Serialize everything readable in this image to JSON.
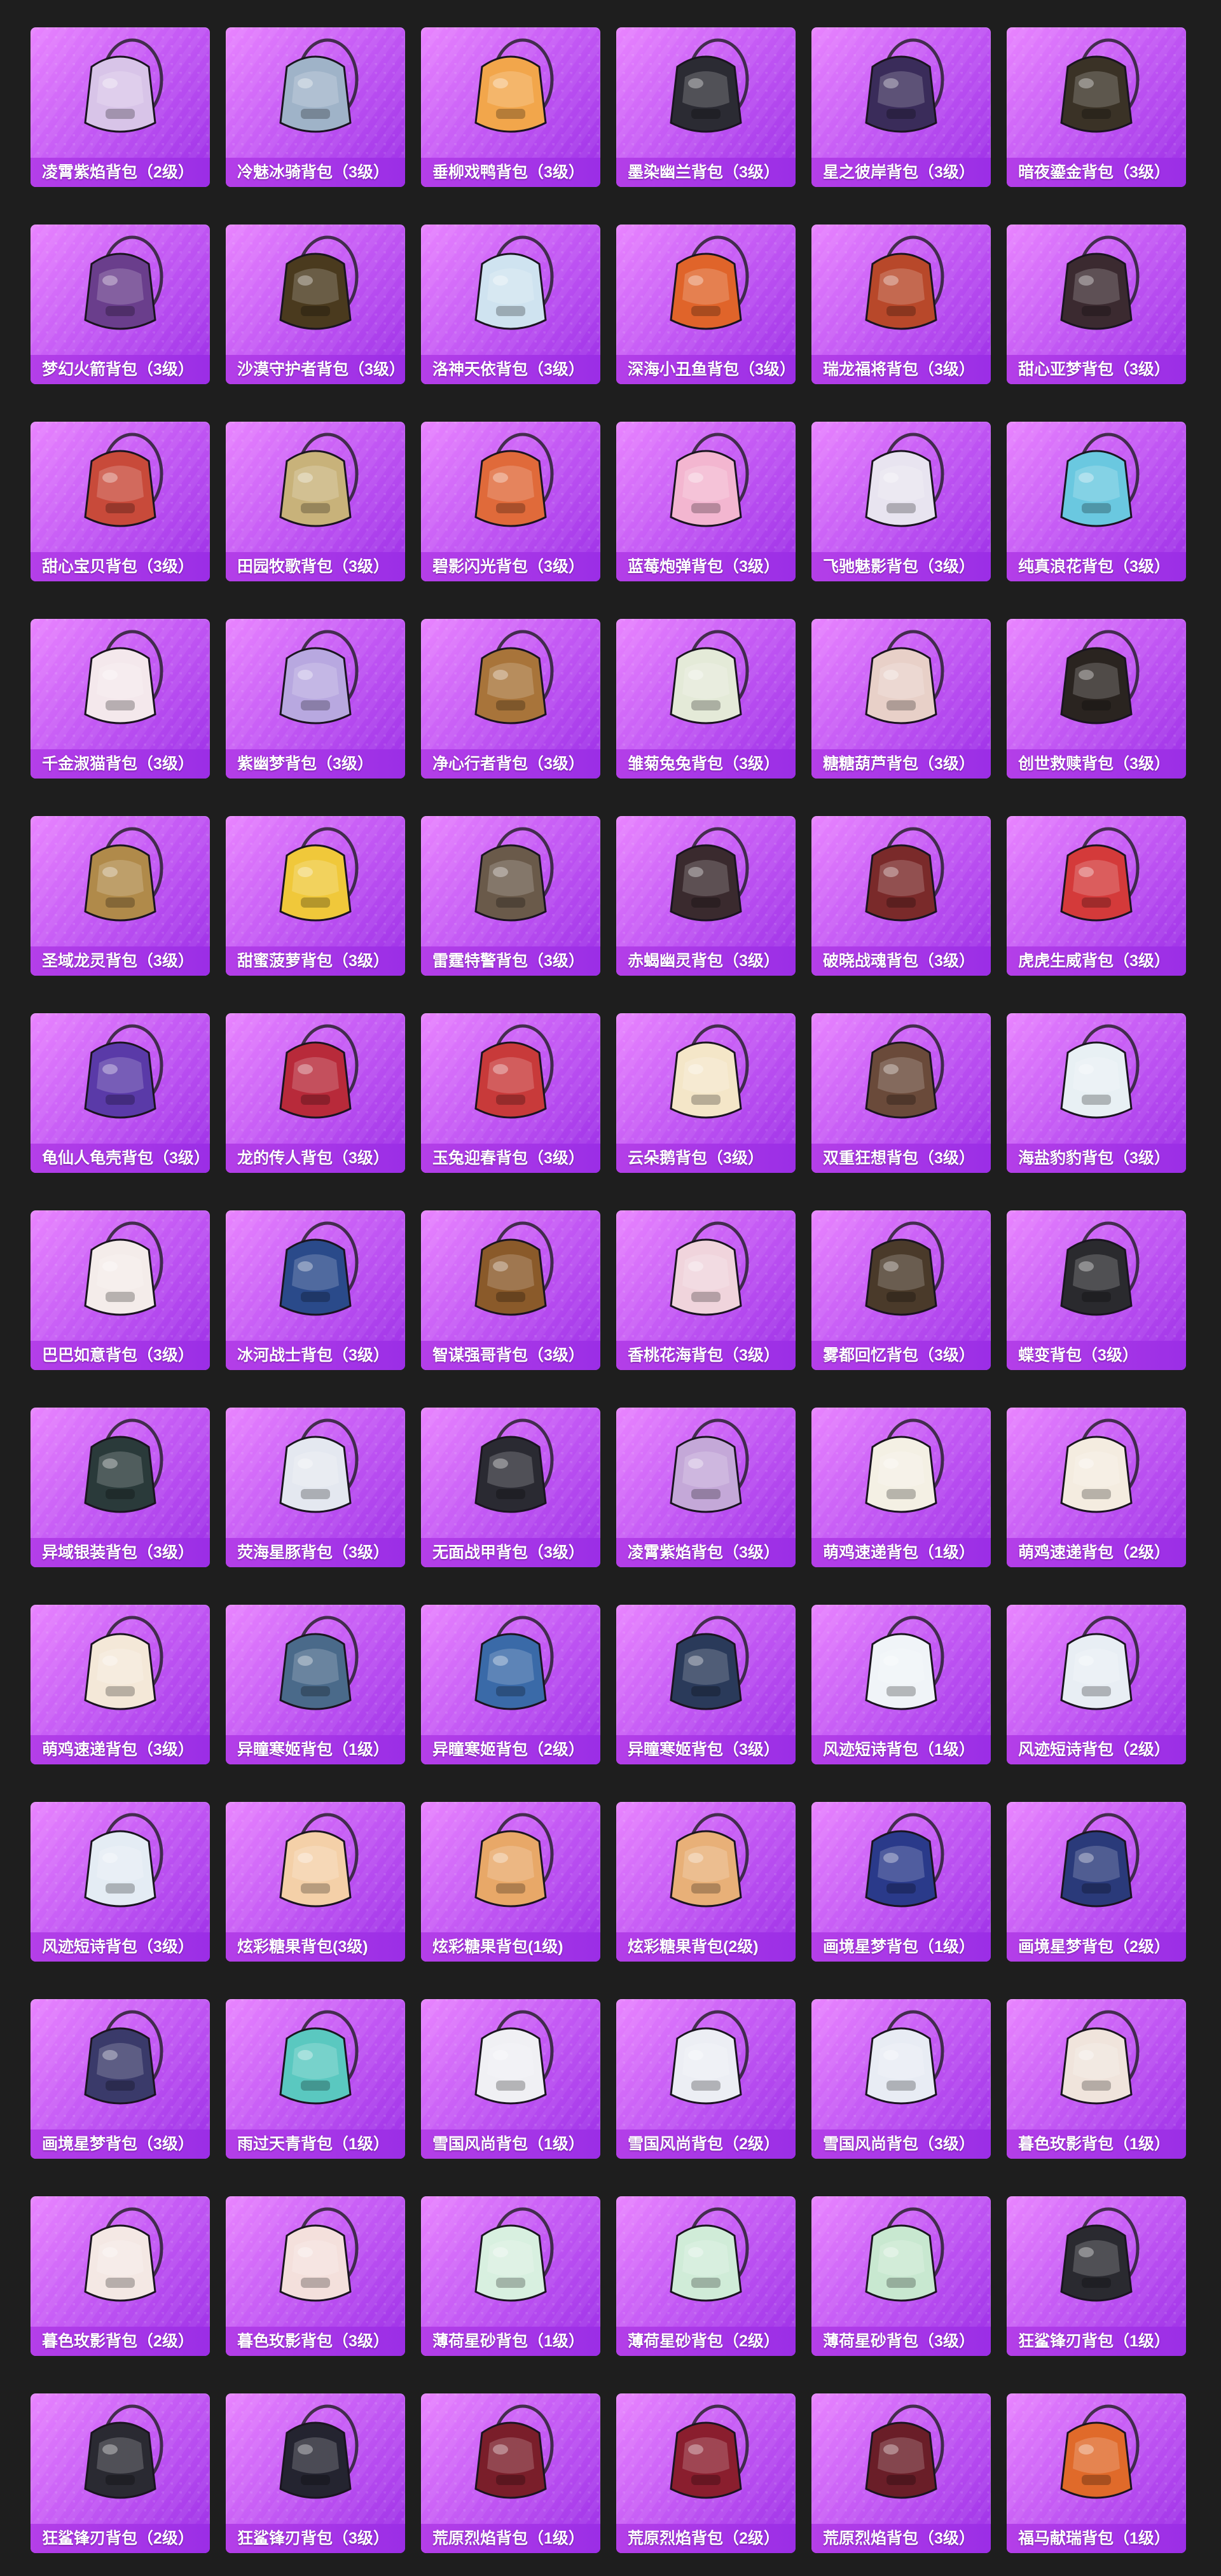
{
  "page": {
    "background": "#1e1e1e"
  },
  "card_style": {
    "gradient_top": "#e985ff",
    "gradient_bottom": "#9b2ee6",
    "label_bar": "#9b2ee6",
    "label_text": "#ffffff"
  },
  "items": [
    {
      "name": "凌霄紫焰背包（2级）",
      "icon": "backpack",
      "color": "#d8c4e8"
    },
    {
      "name": "冷魅冰骑背包（3级）",
      "icon": "backpack",
      "color": "#9fb3c8"
    },
    {
      "name": "垂柳戏鸭背包（3级）",
      "icon": "backpack",
      "color": "#f2a64b"
    },
    {
      "name": "墨染幽兰背包（3级）",
      "icon": "backpack",
      "color": "#2b2b33"
    },
    {
      "name": "星之彼岸背包（3级）",
      "icon": "backpack",
      "color": "#3a2c5a"
    },
    {
      "name": "暗夜鎏金背包（3级）",
      "icon": "backpack",
      "color": "#3a3226"
    },
    {
      "name": "梦幻火箭背包（3级）",
      "icon": "backpack",
      "color": "#6a3e8c"
    },
    {
      "name": "沙漠守护者背包（3级）",
      "icon": "backpack",
      "color": "#4a3a1e"
    },
    {
      "name": "洛神天依背包（3级）",
      "icon": "backpack",
      "color": "#cfe3f0"
    },
    {
      "name": "深海小丑鱼背包（3级）",
      "icon": "backpack",
      "color": "#e0642a"
    },
    {
      "name": "瑞龙福将背包（3级）",
      "icon": "backpack",
      "color": "#b8482a"
    },
    {
      "name": "甜心亚梦背包（3级）",
      "icon": "backpack",
      "color": "#3b2a30"
    },
    {
      "name": "甜心宝贝背包（3级）",
      "icon": "backpack",
      "color": "#c84a3a"
    },
    {
      "name": "田园牧歌背包（3级）",
      "icon": "backpack",
      "color": "#c8b27a"
    },
    {
      "name": "碧影闪光背包（3级）",
      "icon": "backpack",
      "color": "#e06a3a"
    },
    {
      "name": "蓝莓炮弹背包（3级）",
      "icon": "backpack",
      "color": "#f3b6d0"
    },
    {
      "name": "飞驰魅影背包（3级）",
      "icon": "backpack",
      "color": "#e8e4f0"
    },
    {
      "name": "纯真浪花背包（3级）",
      "icon": "backpack",
      "color": "#6ac8e0"
    },
    {
      "name": "千金淑猫背包（3级）",
      "icon": "backpack",
      "color": "#f4e8ec"
    },
    {
      "name": "紫幽梦背包（3级）",
      "icon": "backpack",
      "color": "#b8a8e0"
    },
    {
      "name": "净心行者背包（3级）",
      "icon": "backpack",
      "color": "#a8743a"
    },
    {
      "name": "雏菊兔兔背包（3级）",
      "icon": "backpack",
      "color": "#e4ead8"
    },
    {
      "name": "糖糖葫芦背包（3级）",
      "icon": "backpack",
      "color": "#e8d0c8"
    },
    {
      "name": "创世救赎背包（3级）",
      "icon": "backpack",
      "color": "#2a2420"
    },
    {
      "name": "圣域龙灵背包（3级）",
      "icon": "backpack",
      "color": "#b08a4a"
    },
    {
      "name": "甜蜜菠萝背包（3级）",
      "icon": "backpack",
      "color": "#f0c83a"
    },
    {
      "name": "雷霆特警背包（3级）",
      "icon": "backpack",
      "color": "#6a5a4a"
    },
    {
      "name": "赤蝎幽灵背包（3级）",
      "icon": "backpack",
      "color": "#3a2a2e"
    },
    {
      "name": "破晓战魂背包（3级）",
      "icon": "backpack",
      "color": "#7a2a2a"
    },
    {
      "name": "虎虎生威背包（3级）",
      "icon": "backpack",
      "color": "#d43a3a"
    },
    {
      "name": "龟仙人龟壳背包（3级）",
      "icon": "backpack",
      "color": "#5a3aa8"
    },
    {
      "name": "龙的传人背包（3级）",
      "icon": "backpack",
      "color": "#b82a3a"
    },
    {
      "name": "玉兔迎春背包（3级）",
      "icon": "backpack",
      "color": "#c83a3a"
    },
    {
      "name": "云朵鹅背包（3级）",
      "icon": "backpack",
      "color": "#f4e6c8"
    },
    {
      "name": "双重狂想背包（3级）",
      "icon": "backpack",
      "color": "#6a4a3a"
    },
    {
      "name": "海盐豹豹背包（3级）",
      "icon": "backpack",
      "color": "#e8f0f4"
    },
    {
      "name": "巴巴如意背包（3级）",
      "icon": "backpack",
      "color": "#f4ecea"
    },
    {
      "name": "冰河战士背包（3级）",
      "icon": "backpack",
      "color": "#2a4a8a"
    },
    {
      "name": "智谋强哥背包（3级）",
      "icon": "backpack",
      "color": "#8a5a2a"
    },
    {
      "name": "香桃花海背包（3级）",
      "icon": "backpack",
      "color": "#f0d4dc"
    },
    {
      "name": "雾都回忆背包（3级）",
      "icon": "backpack",
      "color": "#4a3a2a"
    },
    {
      "name": "蝶变背包（3级）",
      "icon": "backpack",
      "color": "#2a2a2e"
    },
    {
      "name": "异域银装背包（3级）",
      "icon": "backpack",
      "color": "#2a3a3a"
    },
    {
      "name": "荧海星豚背包（3级）",
      "icon": "backpack",
      "color": "#e4e8f0"
    },
    {
      "name": "无面战甲背包（3级）",
      "icon": "backpack",
      "color": "#2a2a32"
    },
    {
      "name": "凌霄紫焰背包（3级）",
      "icon": "backpack",
      "color": "#c4a8d8"
    },
    {
      "name": "萌鸡速递背包（1级）",
      "icon": "backpack",
      "color": "#f4f0e4"
    },
    {
      "name": "萌鸡速递背包（2级）",
      "icon": "backpack",
      "color": "#f4ece0"
    },
    {
      "name": "萌鸡速递背包（3级）",
      "icon": "backpack",
      "color": "#f4e8d8"
    },
    {
      "name": "异瞳寒姬背包（1级）",
      "icon": "backpack",
      "color": "#4a6a8a"
    },
    {
      "name": "异瞳寒姬背包（2级）",
      "icon": "backpack",
      "color": "#3a6aa8"
    },
    {
      "name": "异瞳寒姬背包（3级）",
      "icon": "backpack",
      "color": "#2a3a5a"
    },
    {
      "name": "风迹短诗背包（1级）",
      "icon": "backpack",
      "color": "#f0f4f8"
    },
    {
      "name": "风迹短诗背包（2级）",
      "icon": "backpack",
      "color": "#e8eef4"
    },
    {
      "name": "风迹短诗背包（3级）",
      "icon": "backpack",
      "color": "#e4ecf4"
    },
    {
      "name": "炫彩糖果背包(3级)",
      "icon": "backpack",
      "color": "#f4d0a8"
    },
    {
      "name": "炫彩糖果背包(1级)",
      "icon": "backpack",
      "color": "#e8a868"
    },
    {
      "name": "炫彩糖果背包(2级)",
      "icon": "backpack",
      "color": "#e8b078"
    },
    {
      "name": "画境星梦背包（1级）",
      "icon": "backpack",
      "color": "#2a3a8a"
    },
    {
      "name": "画境星梦背包（2级）",
      "icon": "backpack",
      "color": "#2a3a7a"
    },
    {
      "name": "画境星梦背包（3级）",
      "icon": "backpack",
      "color": "#3a3a6a"
    },
    {
      "name": "雨过天青背包（1级）",
      "icon": "backpack",
      "color": "#5ac8c0"
    },
    {
      "name": "雪国风尚背包（1级）",
      "icon": "backpack",
      "color": "#f0f0f4"
    },
    {
      "name": "雪国风尚背包（2级）",
      "icon": "backpack",
      "color": "#eceef4"
    },
    {
      "name": "雪国风尚背包（3级）",
      "icon": "backpack",
      "color": "#e8ecf4"
    },
    {
      "name": "暮色玫影背包（1级）",
      "icon": "backpack",
      "color": "#f0e4dc"
    },
    {
      "name": "暮色玫影背包（2级）",
      "icon": "backpack",
      "color": "#f4e8e4"
    },
    {
      "name": "暮色玫影背包（3级）",
      "icon": "backpack",
      "color": "#f4e0dc"
    },
    {
      "name": "薄荷星砂背包（1级）",
      "icon": "backpack",
      "color": "#d8f0e0"
    },
    {
      "name": "薄荷星砂背包（2级）",
      "icon": "backpack",
      "color": "#d0ecd8"
    },
    {
      "name": "薄荷星砂背包（3级）",
      "icon": "backpack",
      "color": "#c8e8d0"
    },
    {
      "name": "狂鲨锋刃背包（1级）",
      "icon": "backpack",
      "color": "#2a2a30"
    },
    {
      "name": "狂鲨锋刃背包（2级）",
      "icon": "backpack",
      "color": "#2a2a32"
    },
    {
      "name": "狂鲨锋刃背包（3级）",
      "icon": "backpack",
      "color": "#242430"
    },
    {
      "name": "荒原烈焰背包（1级）",
      "icon": "backpack",
      "color": "#7a1e2a"
    },
    {
      "name": "荒原烈焰背包（2级）",
      "icon": "backpack",
      "color": "#8a1e2e"
    },
    {
      "name": "荒原烈焰背包（3级）",
      "icon": "backpack",
      "color": "#6a1e28"
    },
    {
      "name": "福马献瑞背包（1级）",
      "icon": "backpack",
      "color": "#e06a2a"
    }
  ]
}
